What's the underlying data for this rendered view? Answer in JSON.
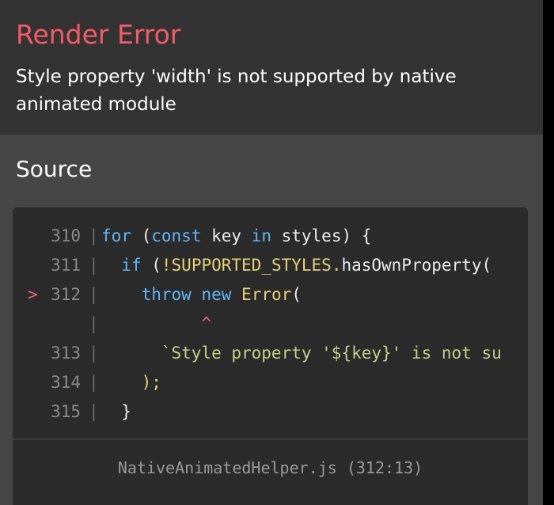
{
  "error": {
    "title": "Render Error",
    "message": "Style property 'width' is not supported by native animated module",
    "title_color": "#f45b69"
  },
  "source": {
    "heading": "Source",
    "lines": [
      {
        "marker": "",
        "number": "310",
        "bar": "|",
        "segments": [
          {
            "t": "for",
            "c": "kw"
          },
          {
            "t": " (",
            "c": ""
          },
          {
            "t": "const",
            "c": "kw"
          },
          {
            "t": " key ",
            "c": ""
          },
          {
            "t": "in",
            "c": "kw"
          },
          {
            "t": " styles) {",
            "c": ""
          }
        ]
      },
      {
        "marker": "",
        "number": "311",
        "bar": "|",
        "segments": [
          {
            "t": "  ",
            "c": ""
          },
          {
            "t": "if",
            "c": "kw"
          },
          {
            "t": " (",
            "c": ""
          },
          {
            "t": "!SUPPORTED_STYLES.",
            "c": "ident"
          },
          {
            "t": "hasOwnProperty(",
            "c": ""
          }
        ]
      },
      {
        "marker": ">",
        "number": "312",
        "bar": "|",
        "segments": [
          {
            "t": "    ",
            "c": ""
          },
          {
            "t": "throw",
            "c": "kw"
          },
          {
            "t": " ",
            "c": ""
          },
          {
            "t": "new",
            "c": "kw"
          },
          {
            "t": " ",
            "c": ""
          },
          {
            "t": "Error",
            "c": "ident"
          },
          {
            "t": "(",
            "c": ""
          }
        ]
      },
      {
        "marker": "",
        "number": "",
        "bar": "|",
        "segments": [
          {
            "t": "          ",
            "c": ""
          },
          {
            "t": "^",
            "c": "caret"
          }
        ]
      },
      {
        "marker": "",
        "number": "313",
        "bar": "|",
        "segments": [
          {
            "t": "      ",
            "c": ""
          },
          {
            "t": "`Style property '${key}' is not su",
            "c": "str"
          }
        ]
      },
      {
        "marker": "",
        "number": "314",
        "bar": "|",
        "segments": [
          {
            "t": "    ",
            "c": ""
          },
          {
            "t": ");",
            "c": "ident"
          }
        ]
      },
      {
        "marker": "",
        "number": "315",
        "bar": "|",
        "segments": [
          {
            "t": "  }",
            "c": ""
          }
        ]
      }
    ],
    "file_reference": "NativeAnimatedHelper.js (312:13)"
  }
}
